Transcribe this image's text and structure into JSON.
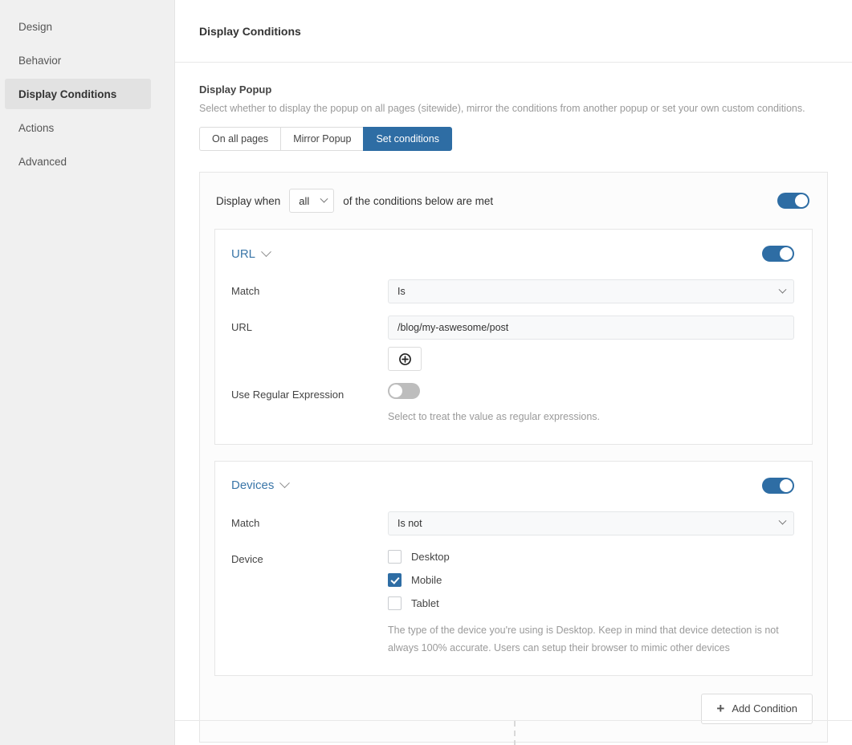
{
  "sidebar": {
    "items": [
      {
        "label": "Design",
        "active": false
      },
      {
        "label": "Behavior",
        "active": false
      },
      {
        "label": "Display Conditions",
        "active": true
      },
      {
        "label": "Actions",
        "active": false
      },
      {
        "label": "Advanced",
        "active": false
      }
    ]
  },
  "header": {
    "title": "Display Conditions"
  },
  "display_popup": {
    "label": "Display Popup",
    "description": "Select whether to display the popup on all pages (sitewide), mirror the conditions from another popup or set your own custom conditions.",
    "tabs": [
      {
        "label": "On all pages",
        "active": false
      },
      {
        "label": "Mirror Popup",
        "active": false
      },
      {
        "label": "Set conditions",
        "active": true
      }
    ]
  },
  "display_when": {
    "prefix": "Display when",
    "match_mode": "all",
    "suffix": "of the conditions below are met",
    "enabled": true
  },
  "conditions": [
    {
      "title": "URL",
      "enabled": true,
      "match_label": "Match",
      "match_value": "Is",
      "value_label": "URL",
      "value": "/blog/my-aswesome/post",
      "add_value_icon": "circle-plus-icon",
      "regex_label": "Use Regular Expression",
      "regex_enabled": false,
      "regex_help": "Select to treat the value as regular expressions."
    },
    {
      "title": "Devices",
      "enabled": true,
      "match_label": "Match",
      "match_value": "Is not",
      "device_label": "Device",
      "devices": [
        {
          "label": "Desktop",
          "checked": false
        },
        {
          "label": "Mobile",
          "checked": true
        },
        {
          "label": "Tablet",
          "checked": false
        }
      ],
      "device_help": "The type of the device you're using is Desktop. Keep in mind that device detection is not always 100% accurate. Users can setup their browser to mimic other devices"
    }
  ],
  "add_condition": {
    "label": "Add Condition",
    "icon": "plus-icon"
  },
  "colors": {
    "accent": "#2e6da4",
    "link": "#3a76a8",
    "toggle_off": "#bdbdbd",
    "sidebar_active_bg": "#e2e2e2"
  }
}
